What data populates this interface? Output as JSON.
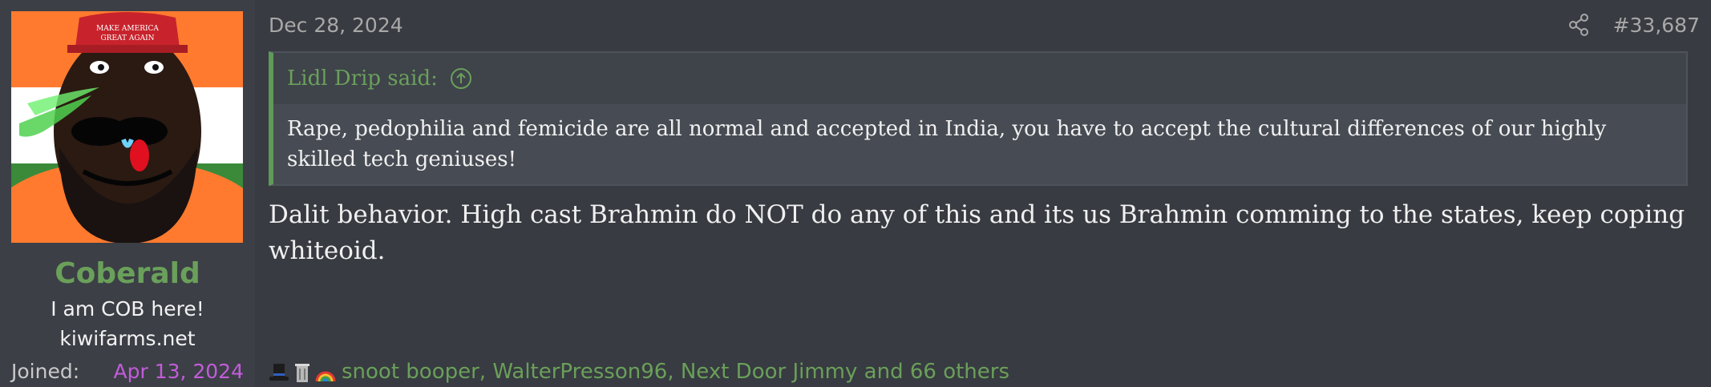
{
  "user": {
    "username": "Coberald",
    "title": "I am COB here!",
    "banner": "kiwifarms.net",
    "joined_label": "Joined:",
    "joined_value": "Apr 13, 2024",
    "avatar_icon": "avatar-image",
    "avatar_hat_text": "MAKE AMERICA GREAT AGAIN"
  },
  "post": {
    "date": "Dec 28, 2024",
    "number": "#33,687",
    "share_icon": "share-icon",
    "quote": {
      "author": "Lidl Drip said:",
      "arrow_icon": "arrow-up-circle-icon",
      "text": "Rape, pedophilia and femicide are all normal and accepted in India, you have to accept the cultural differences of our highly skilled tech geniuses!"
    },
    "body": "Dalit behavior. High cast Brahmin do NOT do any of this and its us Brahmin comming to the states, keep coping whiteoid."
  },
  "reactions": {
    "icons": [
      "top-hat-icon",
      "trash-can-icon",
      "rainbow-icon"
    ],
    "users_text": "snoot booper, WalterPresson96, Next Door Jimmy and 66 others"
  },
  "colors": {
    "accent_green": "#6aa05a",
    "joined_purple": "#c25cd9",
    "background": "#383b41"
  }
}
